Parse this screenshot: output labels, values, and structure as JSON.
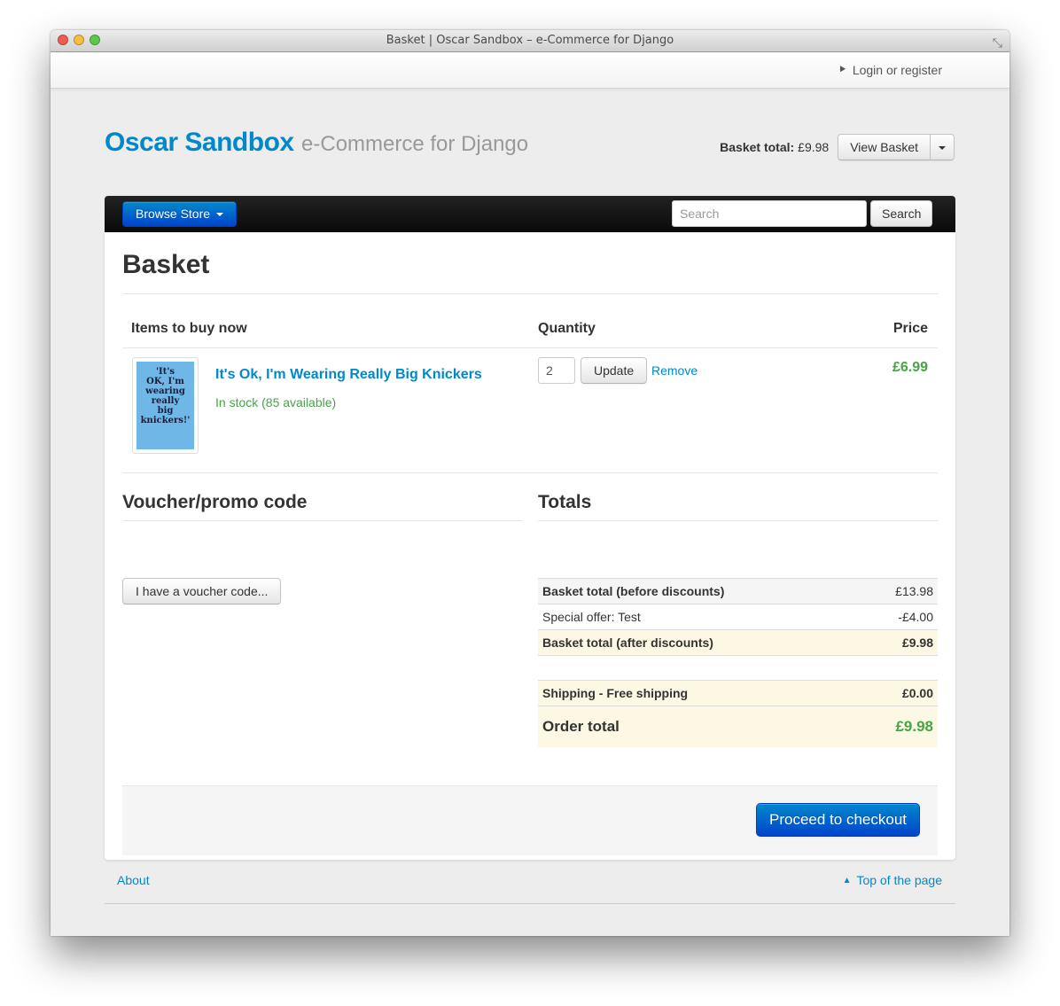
{
  "window": {
    "title": "Basket | Oscar Sandbox – e-Commerce for Django"
  },
  "topbar": {
    "login_label": "Login or register",
    "login_icon": "sign-in-icon"
  },
  "brand": {
    "name": "Oscar Sandbox",
    "tagline": "e-Commerce for Django"
  },
  "mini_basket": {
    "total_label": "Basket total:",
    "total_value": "£9.98",
    "view_label": "View Basket"
  },
  "navbar": {
    "browse_label": "Browse Store",
    "search_placeholder": "Search",
    "search_button": "Search"
  },
  "page": {
    "title": "Basket"
  },
  "basket": {
    "columns": {
      "items": "Items to buy now",
      "quantity": "Quantity",
      "price": "Price"
    },
    "lines": [
      {
        "title": "It's Ok, I'm Wearing Really Big Knickers",
        "availability": "In stock (85 available)",
        "quantity": "2",
        "update_label": "Update",
        "remove_label": "Remove",
        "price": "£6.99"
      }
    ]
  },
  "voucher": {
    "heading": "Voucher/promo code",
    "button_label": "I have a voucher code..."
  },
  "totals": {
    "heading": "Totals",
    "before_label": "Basket total (before discounts)",
    "before_value": "£13.98",
    "offer_label": "Special offer: Test",
    "offer_value": "-£4.00",
    "after_label": "Basket total (after discounts)",
    "after_value": "£9.98",
    "shipping_label": "Shipping - Free shipping",
    "shipping_value": "£0.00",
    "order_label": "Order total",
    "order_value": "£9.98"
  },
  "checkout": {
    "label": "Proceed to checkout"
  },
  "footer": {
    "about": "About",
    "top": "Top of the page"
  },
  "colors": {
    "link": "#0088cc",
    "primary": "#0044cc",
    "success": "#46a546",
    "highlight": "#fcf8e3",
    "navbar": "#111111"
  }
}
